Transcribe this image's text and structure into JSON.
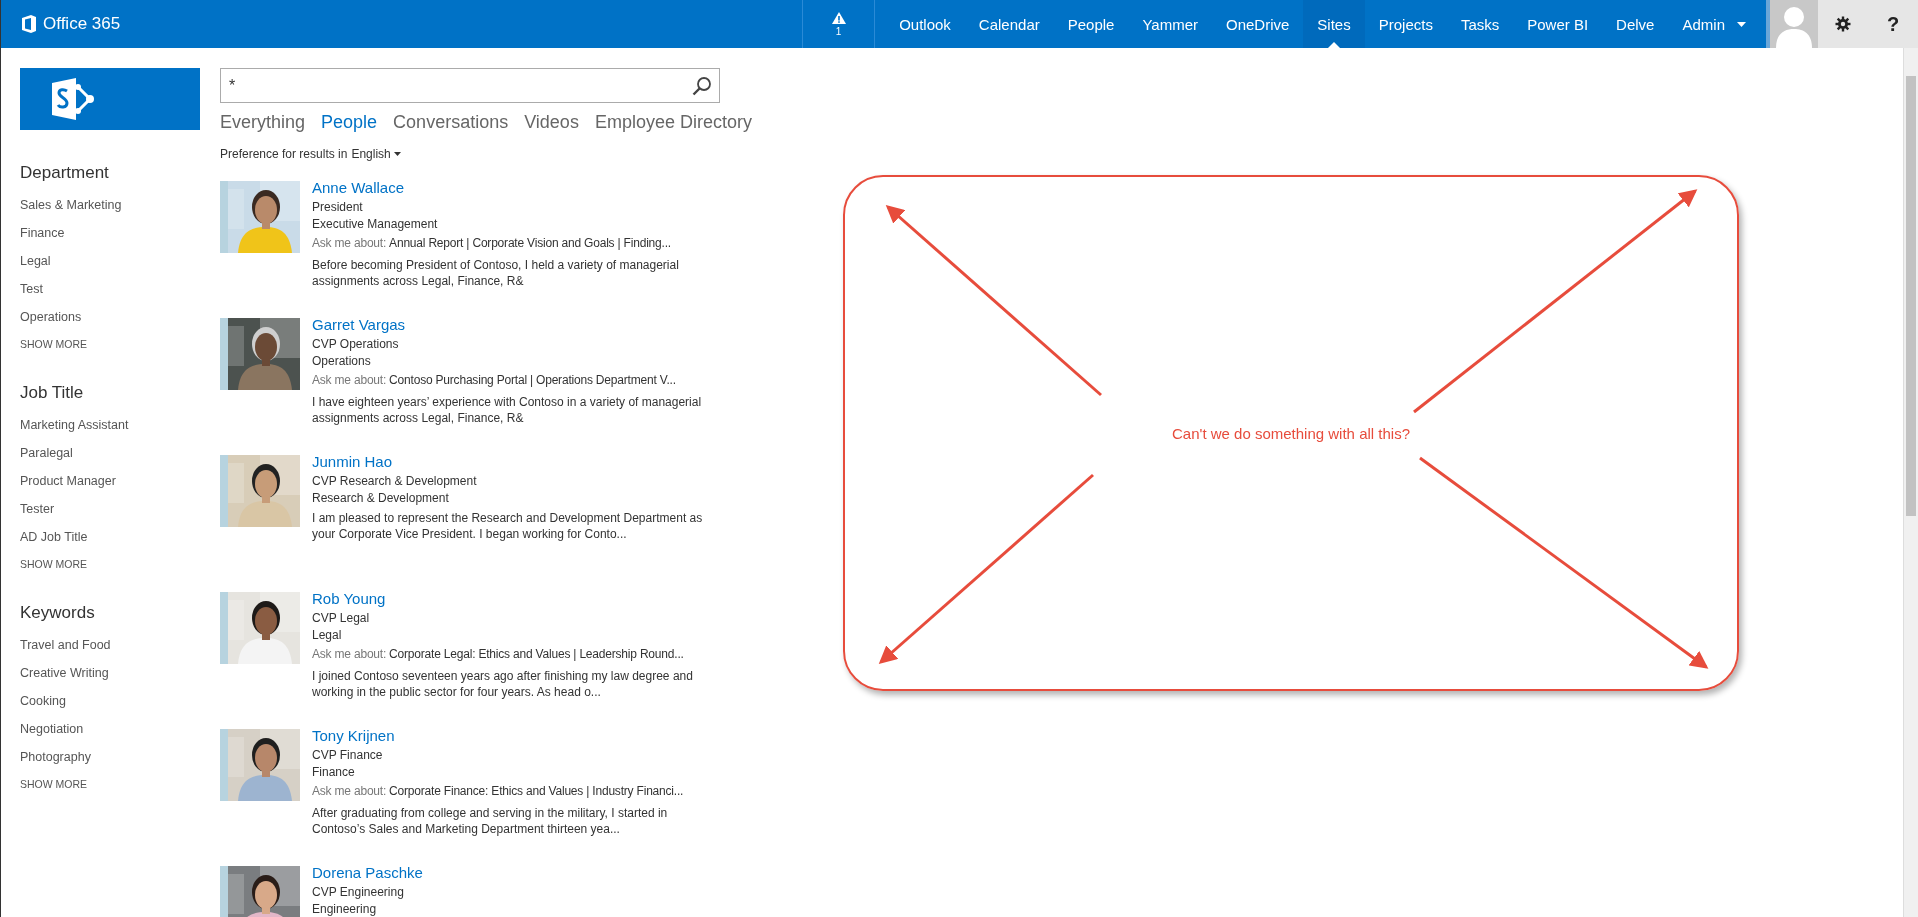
{
  "suite_bar": {
    "brand": "Office 365",
    "alert_count": "1",
    "nav": [
      {
        "label": "Outlook",
        "selected": false
      },
      {
        "label": "Calendar",
        "selected": false
      },
      {
        "label": "People",
        "selected": false
      },
      {
        "label": "Yammer",
        "selected": false
      },
      {
        "label": "OneDrive",
        "selected": false
      },
      {
        "label": "Sites",
        "selected": true
      },
      {
        "label": "Projects",
        "selected": false
      },
      {
        "label": "Tasks",
        "selected": false
      },
      {
        "label": "Power BI",
        "selected": false
      },
      {
        "label": "Delve",
        "selected": false
      },
      {
        "label": "Admin",
        "selected": false,
        "has_menu": true
      }
    ],
    "help": "?"
  },
  "search": {
    "value": "*"
  },
  "tabs": [
    {
      "label": "Everything",
      "selected": false
    },
    {
      "label": "People",
      "selected": true
    },
    {
      "label": "Conversations",
      "selected": false
    },
    {
      "label": "Videos",
      "selected": false
    },
    {
      "label": "Employee Directory",
      "selected": false
    }
  ],
  "preference": {
    "label": "Preference for results in",
    "language": "English"
  },
  "refiners": [
    {
      "heading": "Department",
      "items": [
        "Sales & Marketing",
        "Finance",
        "Legal",
        "Test",
        "Operations"
      ],
      "more": "SHOW MORE"
    },
    {
      "heading": "Job Title",
      "items": [
        "Marketing Assistant",
        "Paralegal",
        "Product Manager",
        "Tester",
        "AD Job Title"
      ],
      "more": "SHOW MORE"
    },
    {
      "heading": "Keywords",
      "items": [
        "Travel and Food",
        "Creative Writing",
        "Cooking",
        "Negotiation",
        "Photography"
      ],
      "more": "SHOW MORE"
    }
  ],
  "results": [
    {
      "name": "Anne Wallace",
      "title": "President",
      "department": "Executive Management",
      "ask_label": "Ask me about:",
      "ask": "Annual Report | Corporate Vision and Goals | Finding...",
      "bio": "Before becoming President of Contoso, I held a variety of managerial assignments across Legal, Finance, R&"
    },
    {
      "name": "Garret Vargas",
      "title": "CVP Operations",
      "department": "Operations",
      "ask_label": "Ask me about:",
      "ask": "Contoso Purchasing Portal | Operations Department V...",
      "bio": "I have eighteen years’ experience with Contoso in a variety of managerial assignments across Legal, Finance, R&"
    },
    {
      "name": "Junmin Hao",
      "title": "CVP Research & Development",
      "department": "Research & Development",
      "bio": "I am pleased to represent the Research and Development Department as your Corporate Vice President. I began working for Conto..."
    },
    {
      "name": "Rob Young",
      "title": "CVP Legal",
      "department": "Legal",
      "ask_label": "Ask me about:",
      "ask": "Corporate Legal: Ethics and Values | Leadership Round...",
      "bio": "I joined Contoso seventeen years ago after finishing my law degree and working in the public sector for four years. As head o..."
    },
    {
      "name": "Tony Krijnen",
      "title": "CVP Finance",
      "department": "Finance",
      "ask_label": "Ask me about:",
      "ask": "Corporate Finance: Ethics and Values | Industry Financi...",
      "bio": "After graduating from college and serving in the military, I started in Contoso’s Sales and Marketing Department thirteen yea..."
    },
    {
      "name": "Dorena Paschke",
      "title": "CVP Engineering",
      "department": "Engineering"
    }
  ],
  "annotation": {
    "text": "Can't we do something with all this?"
  }
}
